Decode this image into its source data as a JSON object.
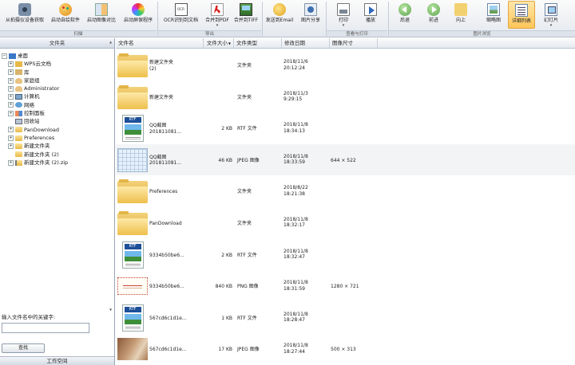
{
  "ribbon": {
    "buttons": [
      {
        "id": "camera",
        "label": "从拍摄仪设备获取",
        "icon": "camera-icon"
      },
      {
        "id": "palette",
        "label": "启动自绘软件",
        "icon": "palette-icon"
      },
      {
        "id": "compare",
        "label": "启动图像对比",
        "icon": "compare-icon"
      },
      {
        "id": "screensaver",
        "label": "启动屏保程序",
        "icon": "screensaver-icon"
      },
      {
        "id": "ocr",
        "label": "OCR识别到文档",
        "icon": "ocr-icon"
      },
      {
        "id": "pdf",
        "label": "合并到PDF",
        "icon": "pdf-icon"
      },
      {
        "id": "tiff",
        "label": "合并到TIFF",
        "icon": "tiff-icon"
      },
      {
        "id": "email",
        "label": "发送到Email",
        "icon": "email-icon"
      },
      {
        "id": "share",
        "label": "图片分享",
        "icon": "share-icon"
      },
      {
        "id": "print",
        "label": "打印",
        "icon": "print-icon"
      },
      {
        "id": "play",
        "label": "播放",
        "icon": "play-icon"
      },
      {
        "id": "back",
        "label": "后退",
        "icon": "back-arrow-icon"
      },
      {
        "id": "forward",
        "label": "前进",
        "icon": "forward-arrow-icon"
      },
      {
        "id": "up",
        "label": "向上",
        "icon": "up-folder-icon"
      },
      {
        "id": "thumb",
        "label": "缩略图",
        "icon": "thumbnail-view-icon"
      },
      {
        "id": "detail",
        "label": "详细列表",
        "icon": "detail-list-icon"
      },
      {
        "id": "slide",
        "label": "幻灯片",
        "icon": "slideshow-icon"
      }
    ],
    "groups": [
      "扫描",
      "导出",
      "查看与打印",
      "图片浏览"
    ],
    "active_view": "详细列表"
  },
  "left": {
    "header": "文件夹",
    "tree": [
      {
        "label": "桌面",
        "icon": "desktop",
        "level": 0,
        "expander": "−"
      },
      {
        "label": "WPS云文档",
        "icon": "wps",
        "level": 1,
        "expander": "+"
      },
      {
        "label": "库",
        "icon": "lib",
        "level": 1,
        "expander": "+"
      },
      {
        "label": "家庭组",
        "icon": "user",
        "level": 1,
        "expander": "+"
      },
      {
        "label": "Administrator",
        "icon": "user",
        "level": 1,
        "expander": "+"
      },
      {
        "label": "计算机",
        "icon": "computer",
        "level": 1,
        "expander": "+"
      },
      {
        "label": "网络",
        "icon": "network",
        "level": 1,
        "expander": "+"
      },
      {
        "label": "控制面板",
        "icon": "control",
        "level": 1,
        "expander": "+"
      },
      {
        "label": "回收站",
        "icon": "recycle",
        "level": 1,
        "expander": ""
      },
      {
        "label": "PanDownload",
        "icon": "folder",
        "level": 1,
        "expander": "+"
      },
      {
        "label": "Preferences",
        "icon": "folder",
        "level": 1,
        "expander": "+"
      },
      {
        "label": "新建文件夹",
        "icon": "folder",
        "level": 1,
        "expander": "+"
      },
      {
        "label": "新建文件夹 (2)",
        "icon": "folder",
        "level": 1,
        "expander": ""
      },
      {
        "label": "新建文件夹 (2).zip",
        "icon": "zip",
        "level": 1,
        "expander": "+"
      }
    ],
    "search_label": "输入文件名中的关键字:",
    "search_value": "",
    "search_button": "查找",
    "workspace_header": "工作空间"
  },
  "list": {
    "columns": [
      "文件名",
      "文件大小",
      "文件类型",
      "修改日期",
      "图像尺寸"
    ],
    "rows": [
      {
        "thumb": "folder",
        "name": "新建文件夹\n(2)",
        "size": "",
        "type": "文件夹",
        "date": "2018/11/6\n20:12:24",
        "dim": ""
      },
      {
        "thumb": "folder",
        "name": "新建文件夹",
        "size": "",
        "type": "文件夹",
        "date": "2018/11/3\n9:29:15",
        "dim": ""
      },
      {
        "thumb": "rtf",
        "name": "QQ截图\n201811081...",
        "size": "2 KB",
        "type": "RTF 文件",
        "date": "2018/11/8\n18:34:13",
        "dim": ""
      },
      {
        "thumb": "grid",
        "name": "QQ截图\n201811081...",
        "size": "46 KB",
        "type": "JPEG 图像",
        "date": "2018/11/8\n18:33:59",
        "dim": "644 × 522",
        "selected": true
      },
      {
        "thumb": "folder",
        "name": "Preferences",
        "size": "",
        "type": "文件夹",
        "date": "2018/8/22\n18:21:38",
        "dim": ""
      },
      {
        "thumb": "folder",
        "name": "PanDownload",
        "size": "",
        "type": "文件夹",
        "date": "2018/11/8\n18:32:17",
        "dim": ""
      },
      {
        "thumb": "rtf",
        "name": "9334b50be6...",
        "size": "2 KB",
        "type": "RTF 文件",
        "date": "2018/11/8\n18:32:47",
        "dim": ""
      },
      {
        "thumb": "card",
        "name": "9334b50be6...",
        "size": "840 KB",
        "type": "PNG 图像",
        "date": "2018/11/8\n18:31:59",
        "dim": "1280 × 721"
      },
      {
        "thumb": "rtf",
        "name": "567cd6c1d1e...",
        "size": "1 KB",
        "type": "RTF 文件",
        "date": "2018/11/8\n18:28:47",
        "dim": ""
      },
      {
        "thumb": "photo",
        "name": "567cd6c1d1e...",
        "size": "17 KB",
        "type": "JPEG 图像",
        "date": "2018/11/8\n18:27:44",
        "dim": "500 × 313"
      }
    ]
  },
  "colors": {
    "accent_active": "#ffc65a",
    "panel_header": "#d4dbe5",
    "folder": "#e7b846"
  }
}
